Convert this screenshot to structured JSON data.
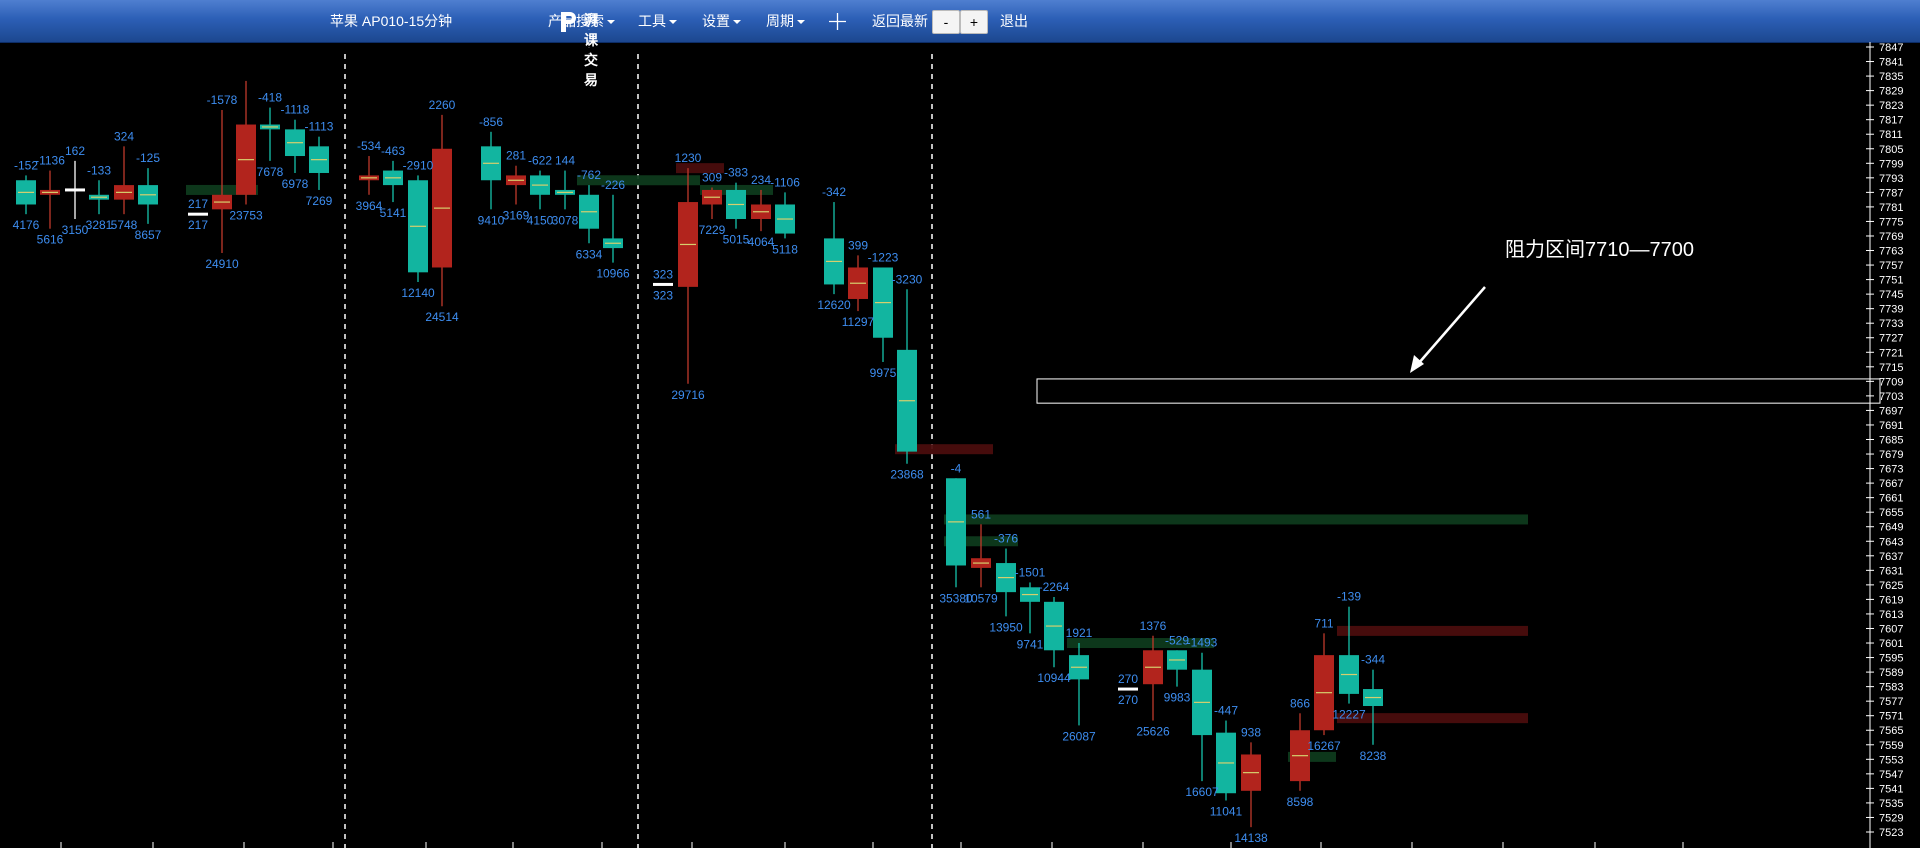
{
  "toolbar": {
    "symbol_title": "苹果 AP010-15分钟",
    "logo_text": "湃课交易",
    "menu_product_search": "产品搜索",
    "menu_tools": "工具",
    "menu_settings": "设置",
    "menu_period": "周期",
    "back_latest": "返回最新",
    "zoom_out": "-",
    "zoom_in": "+",
    "exit": "退出"
  },
  "colors": {
    "up": "#b2241d",
    "down": "#12b5a0",
    "label": "#3d8df0",
    "toolbar": "#2c5fb6"
  },
  "chart_data": {
    "type": "candlestick",
    "annotation": "阻力区间7710—7700",
    "resistance_zone": [
      7700,
      7710
    ],
    "y_ticks": [
      7847,
      7841,
      7835,
      7829,
      7823,
      7817,
      7811,
      7805,
      7799,
      7793,
      7787,
      7781,
      7775,
      7769,
      7763,
      7757,
      7751,
      7745,
      7739,
      7733,
      7727,
      7721,
      7715,
      7709,
      7703,
      7697,
      7691,
      7685,
      7679,
      7673,
      7667,
      7661,
      7655,
      7649,
      7643,
      7637,
      7631,
      7625,
      7619,
      7613,
      7607,
      7601,
      7595,
      7589,
      7583,
      7577,
      7571,
      7565,
      7559,
      7553,
      7547,
      7541,
      7535,
      7529,
      7523
    ],
    "ylim": [
      7520,
      7850
    ],
    "bars": [
      {
        "o": 7792,
        "h": 7794,
        "l": 7778,
        "c": 7782,
        "top": "-152",
        "bottom": "4176"
      },
      {
        "o": 7786,
        "h": 7796,
        "l": 7772,
        "c": 7788,
        "top": "-1136",
        "bottom": "5616"
      },
      {
        "o": 7788,
        "h": 7800,
        "l": 7776,
        "c": 7788,
        "top": "162",
        "bottom": "3150"
      },
      {
        "o": 7786,
        "h": 7792,
        "l": 7778,
        "c": 7784,
        "top": "-133",
        "bottom": "3281"
      },
      {
        "o": 7784,
        "h": 7806,
        "l": 7778,
        "c": 7790,
        "top": "324",
        "bottom": "5748"
      },
      {
        "o": 7790,
        "h": 7797,
        "l": 7774,
        "c": 7782,
        "top": "-125",
        "bottom": "8657"
      },
      {
        "o": 7778,
        "h": 7778,
        "l": 7778,
        "c": 7778,
        "top": "217",
        "bottom": "217"
      },
      {
        "o": 7780,
        "h": 7821,
        "l": 7762,
        "c": 7786,
        "top": "-1578",
        "bottom": "24910"
      },
      {
        "o": 7786,
        "h": 7833,
        "l": 7782,
        "c": 7815,
        "top": "",
        "bottom": "23753"
      },
      {
        "o": 7815,
        "h": 7822,
        "l": 7800,
        "c": 7813,
        "top": "-418",
        "bottom": "7678"
      },
      {
        "o": 7813,
        "h": 7817,
        "l": 7795,
        "c": 7802,
        "top": "-1118",
        "bottom": "6978"
      },
      {
        "o": 7806,
        "h": 7810,
        "l": 7788,
        "c": 7795,
        "top": "-1113",
        "bottom": "7269"
      },
      {
        "o": 7792,
        "h": 7802,
        "l": 7786,
        "c": 7794,
        "top": "-534",
        "bottom": "3964"
      },
      {
        "o": 7796,
        "h": 7800,
        "l": 7783,
        "c": 7790,
        "top": "-463",
        "bottom": "5141"
      },
      {
        "o": 7792,
        "h": 7794,
        "l": 7750,
        "c": 7754,
        "top": "-2910",
        "bottom": "12140"
      },
      {
        "o": 7756,
        "h": 7819,
        "l": 7740,
        "c": 7805,
        "top": "2260",
        "bottom": "24514"
      },
      {
        "o": 7806,
        "h": 7812,
        "l": 7780,
        "c": 7792,
        "top": "-856",
        "bottom": "9410"
      },
      {
        "o": 7790,
        "h": 7798,
        "l": 7782,
        "c": 7794,
        "top": "281",
        "bottom": "3169"
      },
      {
        "o": 7794,
        "h": 7796,
        "l": 7780,
        "c": 7786,
        "top": "-622",
        "bottom": "4150"
      },
      {
        "o": 7788,
        "h": 7796,
        "l": 7780,
        "c": 7786,
        "top": "144",
        "bottom": "3078"
      },
      {
        "o": 7786,
        "h": 7790,
        "l": 7766,
        "c": 7772,
        "top": "-762",
        "bottom": "6334"
      },
      {
        "o": 7768,
        "h": 7786,
        "l": 7758,
        "c": 7764,
        "top": "-226",
        "bottom": "10966"
      },
      {
        "o": 7749,
        "h": 7749,
        "l": 7749,
        "c": 7749,
        "top": "323",
        "bottom": "323"
      },
      {
        "o": 7748,
        "h": 7797,
        "l": 7708,
        "c": 7783,
        "top": "1230",
        "bottom": "29716"
      },
      {
        "o": 7782,
        "h": 7789,
        "l": 7776,
        "c": 7788,
        "top": "309",
        "bottom": "7229"
      },
      {
        "o": 7788,
        "h": 7791,
        "l": 7772,
        "c": 7776,
        "top": "-383",
        "bottom": "5015"
      },
      {
        "o": 7776,
        "h": 7788,
        "l": 7771,
        "c": 7782,
        "top": "234",
        "bottom": "4064"
      },
      {
        "o": 7782,
        "h": 7787,
        "l": 7768,
        "c": 7770,
        "top": "-1106",
        "bottom": "5118"
      },
      {
        "o": 7768,
        "h": 7783,
        "l": 7745,
        "c": 7749,
        "top": "-342",
        "bottom": "12620"
      },
      {
        "o": 7743,
        "h": 7761,
        "l": 7738,
        "c": 7756,
        "top": "399",
        "bottom": "11297"
      },
      {
        "o": 7756,
        "h": 7756,
        "l": 7717,
        "c": 7727,
        "top": "-1223",
        "bottom": "9975"
      },
      {
        "o": 7722,
        "h": 7747,
        "l": 7675,
        "c": 7680,
        "top": "-3230",
        "bottom": "23868"
      },
      {
        "o": 7669,
        "h": 7669,
        "l": 7624,
        "c": 7633,
        "top": "-4",
        "bottom": "35380"
      },
      {
        "o": 7632,
        "h": 7650,
        "l": 7624,
        "c": 7636,
        "top": "561",
        "bottom": "10579"
      },
      {
        "o": 7634,
        "h": 7640,
        "l": 7612,
        "c": 7622,
        "top": "-376",
        "bottom": "13950"
      },
      {
        "o": 7624,
        "h": 7626,
        "l": 7605,
        "c": 7618,
        "top": "-1501",
        "bottom": "9741"
      },
      {
        "o": 7618,
        "h": 7620,
        "l": 7591,
        "c": 7598,
        "top": "-2264",
        "bottom": "10944"
      },
      {
        "o": 7596,
        "h": 7601,
        "l": 7567,
        "c": 7586,
        "top": "1921",
        "bottom": "26087"
      },
      {
        "o": 7582,
        "h": 7582,
        "l": 7582,
        "c": 7582,
        "top": "270",
        "bottom": "270"
      },
      {
        "o": 7584,
        "h": 7604,
        "l": 7569,
        "c": 7598,
        "top": "1376",
        "bottom": "25626"
      },
      {
        "o": 7598,
        "h": 7598,
        "l": 7583,
        "c": 7590,
        "top": "-529",
        "bottom": "9983"
      },
      {
        "o": 7590,
        "h": 7597,
        "l": 7544,
        "c": 7563,
        "top": "-1493",
        "bottom": "16607"
      },
      {
        "o": 7564,
        "h": 7569,
        "l": 7536,
        "c": 7539,
        "top": "-447",
        "bottom": "11041"
      },
      {
        "o": 7540,
        "h": 7560,
        "l": 7525,
        "c": 7555,
        "top": "938",
        "bottom": "14138"
      },
      {
        "o": 7544,
        "h": 7572,
        "l": 7540,
        "c": 7565,
        "top": "866",
        "bottom": "8598"
      },
      {
        "o": 7565,
        "h": 7605,
        "l": 7563,
        "c": 7596,
        "top": "711",
        "bottom": "16267"
      },
      {
        "o": 7596,
        "h": 7616,
        "l": 7576,
        "c": 7580,
        "top": "-139",
        "bottom": "12227"
      },
      {
        "o": 7582,
        "h": 7590,
        "l": 7559,
        "c": 7575,
        "top": "-344",
        "bottom": "8238"
      }
    ],
    "zones": [
      {
        "from": 6,
        "to": 8,
        "price": 7788,
        "color": "green"
      },
      {
        "from": 20,
        "to": 23,
        "price": 7792,
        "color": "green"
      },
      {
        "from": 24,
        "to": 26,
        "price": 7788,
        "color": "green"
      },
      {
        "from": 23,
        "to": 24,
        "price": 7797,
        "color": "red"
      },
      {
        "from": 31,
        "to": 33,
        "price": 7681,
        "color": "red"
      },
      {
        "from": 32,
        "to": 48,
        "price": 7652,
        "color": "green"
      },
      {
        "from": 32,
        "to": 34,
        "price": 7643,
        "color": "green"
      },
      {
        "from": 37,
        "to": 41,
        "price": 7601,
        "color": "green"
      },
      {
        "from": 44,
        "to": 45,
        "price": 7554,
        "color": "green"
      },
      {
        "from": 46,
        "to": 48,
        "price": 7606,
        "color": "red"
      },
      {
        "from": 46,
        "to": 48,
        "price": 7570,
        "color": "red"
      }
    ]
  }
}
